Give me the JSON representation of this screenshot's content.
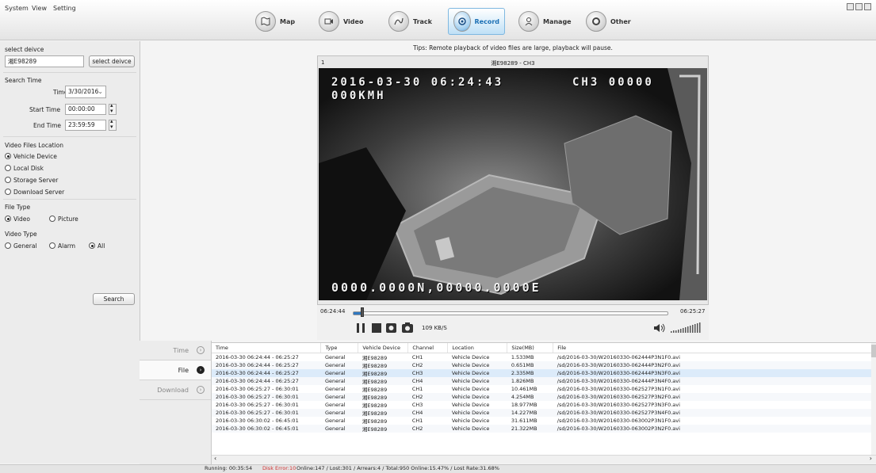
{
  "menu": [
    "System",
    "View",
    "Setting"
  ],
  "nav": [
    {
      "label": "Map",
      "icon": "map-icon"
    },
    {
      "label": "Video",
      "icon": "video-icon"
    },
    {
      "label": "Track",
      "icon": "track-icon"
    },
    {
      "label": "Record",
      "icon": "record-icon",
      "active": true
    },
    {
      "label": "Manage",
      "icon": "manage-icon"
    },
    {
      "label": "Other",
      "icon": "other-icon"
    }
  ],
  "left": {
    "select_device_label": "select deivce",
    "device_value": "湘E98289",
    "select_device_button": "select deivce",
    "search_time_label": "Search Time",
    "time_label": "Time",
    "time_value": "3/30/2016",
    "start_time_label": "Start Time",
    "start_time_value": "00:00:00",
    "end_time_label": "End Time",
    "end_time_value": "23:59:59",
    "location_label": "Video Files Location",
    "location_options": [
      "Vehicle Device",
      "Local Disk",
      "Storage Server",
      "Download Server"
    ],
    "file_type_label": "File Type",
    "file_type_options": [
      "Video",
      "Picture"
    ],
    "video_type_label": "Video Type",
    "video_type_options": [
      "General",
      "Alarm",
      "All"
    ],
    "search_button": "Search"
  },
  "player": {
    "tips": "Tips: Remote playback of video files are large, playback will pause.",
    "index": "1",
    "title": "湘E98289 - CH3",
    "osd_datetime": "2016-03-30 06:24:43",
    "osd_channel": "CH3 00000",
    "osd_speed": "000KMH",
    "osd_gps": "0000.0000N,00000.0000E",
    "start_time": "06:24:44",
    "end_time": "06:25:27",
    "progress": 0.03,
    "rate": "109 KB/S"
  },
  "tabs": [
    "Time",
    "File",
    "Download"
  ],
  "table": {
    "columns": [
      "Time",
      "Type",
      "Vehicle Device",
      "Channel",
      "Location",
      "Size(MB)",
      "File"
    ],
    "rows": [
      [
        "2016-03-30 06:24:44 - 06:25:27",
        "General",
        "湘E98289",
        "CH1",
        "Vehicle Device",
        "1.533MB",
        "/sd/2016-03-30/W20160330-062444P3N1F0.avi"
      ],
      [
        "2016-03-30 06:24:44 - 06:25:27",
        "General",
        "湘E98289",
        "CH2",
        "Vehicle Device",
        "0.651MB",
        "/sd/2016-03-30/W20160330-062444P3N2F0.avi"
      ],
      [
        "2016-03-30 06:24:44 - 06:25:27",
        "General",
        "湘E98289",
        "CH3",
        "Vehicle Device",
        "2.335MB",
        "/sd/2016-03-30/W20160330-062444P3N3F0.avi"
      ],
      [
        "2016-03-30 06:24:44 - 06:25:27",
        "General",
        "湘E98289",
        "CH4",
        "Vehicle Device",
        "1.826MB",
        "/sd/2016-03-30/W20160330-062444P3N4F0.avi"
      ],
      [
        "2016-03-30 06:25:27 - 06:30:01",
        "General",
        "湘E98289",
        "CH1",
        "Vehicle Device",
        "10.461MB",
        "/sd/2016-03-30/W20160330-062527P3N1F0.avi"
      ],
      [
        "2016-03-30 06:25:27 - 06:30:01",
        "General",
        "湘E98289",
        "CH2",
        "Vehicle Device",
        "4.254MB",
        "/sd/2016-03-30/W20160330-062527P3N2F0.avi"
      ],
      [
        "2016-03-30 06:25:27 - 06:30:01",
        "General",
        "湘E98289",
        "CH3",
        "Vehicle Device",
        "18.977MB",
        "/sd/2016-03-30/W20160330-062527P3N3F0.avi"
      ],
      [
        "2016-03-30 06:25:27 - 06:30:01",
        "General",
        "湘E98289",
        "CH4",
        "Vehicle Device",
        "14.227MB",
        "/sd/2016-03-30/W20160330-062527P3N4F0.avi"
      ],
      [
        "2016-03-30 06:30:02 - 06:45:01",
        "General",
        "湘E98289",
        "CH1",
        "Vehicle Device",
        "31.611MB",
        "/sd/2016-03-30/W20160330-063002P3N1F0.avi"
      ],
      [
        "2016-03-30 06:30:02 - 06:45:01",
        "General",
        "湘E98289",
        "CH2",
        "Vehicle Device",
        "21.322MB",
        "/sd/2016-03-30/W20160330-063002P3N2F0.avi"
      ]
    ]
  },
  "status": {
    "running": "Running: 00:35:54",
    "disk_error": "Disk Error:10",
    "stats": "Online:147 / Lost:301 / Arrears:4 / Total:950   Online:15.47% / Lost Rate:31.68%"
  },
  "colors": {
    "accent": "#1a6fb5",
    "error": "#d03030",
    "selected_row": "#dcebfa"
  }
}
